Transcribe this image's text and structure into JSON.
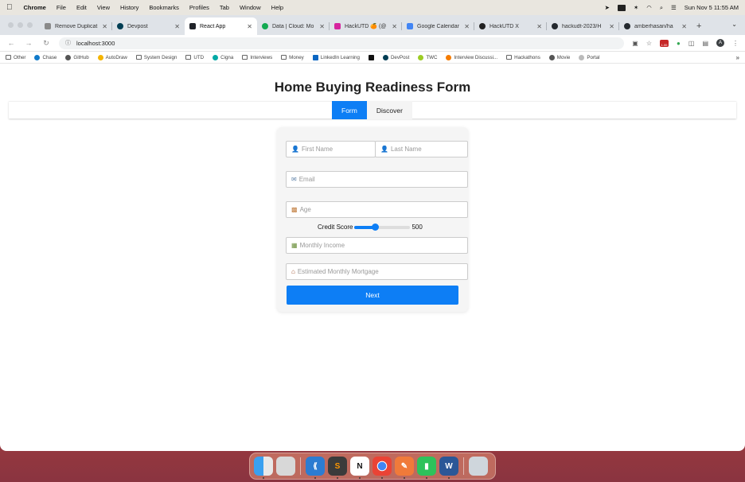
{
  "menubar": {
    "app_name": "Chrome",
    "items": [
      "File",
      "Edit",
      "View",
      "History",
      "Bookmarks",
      "Profiles",
      "Tab",
      "Window",
      "Help"
    ],
    "datetime": "Sun Nov 5  11:55 AM"
  },
  "tabs": [
    {
      "label": "Remove Duplicat",
      "icon": "leetcode-icon",
      "active": false
    },
    {
      "label": "Devpost",
      "icon": "devpost-icon",
      "active": false
    },
    {
      "label": "React App",
      "icon": "react-icon",
      "active": true
    },
    {
      "label": "Data | Cloud: Mo",
      "icon": "mongodb-icon",
      "active": false
    },
    {
      "label": "HackUTD 🍊 (@",
      "icon": "instagram-icon",
      "active": false
    },
    {
      "label": "Google Calendar",
      "icon": "calendar-icon",
      "active": false
    },
    {
      "label": "HackUTD X",
      "icon": "hackutd-icon",
      "active": false
    },
    {
      "label": "hackudt-2023/H",
      "icon": "github-icon",
      "active": false
    },
    {
      "label": "amberhasan/ha",
      "icon": "github-icon",
      "active": false
    }
  ],
  "toolbar": {
    "url": "localhost:3000",
    "extension_badge": "1.00",
    "profile_initial": "A"
  },
  "bookmarks": [
    {
      "label": "Other",
      "icon": "folder-icon"
    },
    {
      "label": "Chase",
      "icon": "chase-icon"
    },
    {
      "label": "GitHub",
      "icon": "github-icon"
    },
    {
      "label": "AutoDraw",
      "icon": "autodraw-icon"
    },
    {
      "label": "System Design",
      "icon": "folder-icon"
    },
    {
      "label": "UTD",
      "icon": "folder-icon"
    },
    {
      "label": "Cigna",
      "icon": "cigna-icon"
    },
    {
      "label": "Interviews",
      "icon": "folder-icon"
    },
    {
      "label": "Money",
      "icon": "folder-icon"
    },
    {
      "label": "LinkedIn Learning",
      "icon": "linkedin-icon"
    },
    {
      "label": "",
      "icon": "bo-icon"
    },
    {
      "label": "DevPost",
      "icon": "devpost-icon"
    },
    {
      "label": "TWC",
      "icon": "twc-icon"
    },
    {
      "label": "Interview Discussi...",
      "icon": "leetcode-icon"
    },
    {
      "label": "Hackathons",
      "icon": "folder-icon"
    },
    {
      "label": "Movie",
      "icon": "github-icon"
    },
    {
      "label": "Portal",
      "icon": "portal-icon"
    }
  ],
  "page": {
    "title": "Home Buying Readiness Form",
    "nav": {
      "form": "Form",
      "discover": "Discover"
    },
    "form": {
      "first_name_placeholder": "First Name",
      "last_name_placeholder": "Last Name",
      "email_placeholder": "Email",
      "age_placeholder": "Age",
      "credit_score_label": "Credit Score",
      "credit_score_value": "500",
      "credit_score_fraction": 0.37,
      "monthly_income_placeholder": "Monthly Income",
      "mortgage_placeholder": "Estimated Monthly Mortgage",
      "next_label": "Next"
    }
  },
  "dock": [
    "Finder",
    "Launchpad",
    "VS Code",
    "Sublime Text",
    "Notion",
    "Chrome",
    "Pencil",
    "Numbers",
    "Word",
    "Trash"
  ],
  "colors": {
    "accent": "#0d7ef5"
  }
}
